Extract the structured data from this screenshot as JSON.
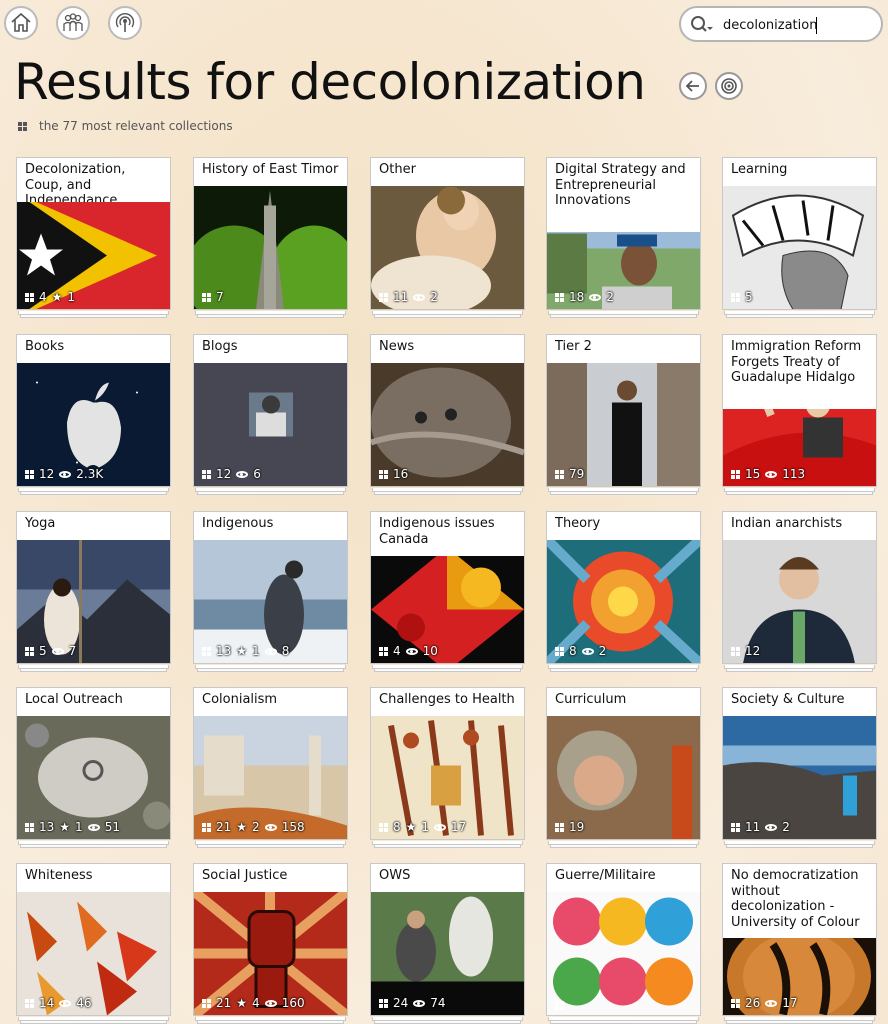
{
  "nav": {
    "home_icon": "home-icon",
    "people_icon": "people-icon",
    "broadcast_icon": "broadcast-icon"
  },
  "search": {
    "value": "decolonization",
    "icon": "search-icon"
  },
  "header": {
    "title": "Results for decolonization",
    "subtitle": "the 77 most relevant collections"
  },
  "collections": [
    {
      "title": "Decolonization, Coup, and Independance",
      "stats": [
        {
          "type": "items",
          "value": "4"
        },
        {
          "type": "stars",
          "value": "1"
        }
      ]
    },
    {
      "title": "History of East Timor",
      "stats": [
        {
          "type": "items",
          "value": "7"
        }
      ]
    },
    {
      "title": "Other",
      "stats": [
        {
          "type": "items",
          "value": "11"
        },
        {
          "type": "views",
          "value": "2"
        }
      ]
    },
    {
      "title": "Digital Strategy and Entrepreneurial Innovations",
      "stats": [
        {
          "type": "items",
          "value": "18"
        },
        {
          "type": "views",
          "value": "2"
        }
      ]
    },
    {
      "title": "Learning",
      "stats": [
        {
          "type": "items",
          "value": "5"
        }
      ]
    },
    {
      "title": "Books",
      "stats": [
        {
          "type": "items",
          "value": "12"
        },
        {
          "type": "views",
          "value": "2.3K"
        }
      ]
    },
    {
      "title": "Blogs",
      "stats": [
        {
          "type": "items",
          "value": "12"
        },
        {
          "type": "views",
          "value": "6"
        }
      ]
    },
    {
      "title": "News",
      "stats": [
        {
          "type": "items",
          "value": "16"
        }
      ]
    },
    {
      "title": "Tier 2",
      "stats": [
        {
          "type": "items",
          "value": "79"
        }
      ]
    },
    {
      "title": "Immigration Reform Forgets Treaty of Guadalupe Hidalgo",
      "stats": [
        {
          "type": "items",
          "value": "15"
        },
        {
          "type": "views",
          "value": "113"
        }
      ]
    },
    {
      "title": "Yoga",
      "stats": [
        {
          "type": "items",
          "value": "5"
        },
        {
          "type": "views",
          "value": "7"
        }
      ]
    },
    {
      "title": "Indigenous",
      "stats": [
        {
          "type": "items",
          "value": "13"
        },
        {
          "type": "stars",
          "value": "1"
        },
        {
          "type": "views",
          "value": "8"
        }
      ]
    },
    {
      "title": "Indigenous issues Canada",
      "stats": [
        {
          "type": "items",
          "value": "4"
        },
        {
          "type": "views",
          "value": "10"
        }
      ]
    },
    {
      "title": "Theory",
      "stats": [
        {
          "type": "items",
          "value": "8"
        },
        {
          "type": "views",
          "value": "2"
        }
      ]
    },
    {
      "title": "Indian anarchists",
      "stats": [
        {
          "type": "items",
          "value": "12"
        }
      ]
    },
    {
      "title": "Local Outreach",
      "stats": [
        {
          "type": "items",
          "value": "13"
        },
        {
          "type": "stars",
          "value": "1"
        },
        {
          "type": "views",
          "value": "51"
        }
      ]
    },
    {
      "title": "Colonialism",
      "stats": [
        {
          "type": "items",
          "value": "21"
        },
        {
          "type": "stars",
          "value": "2"
        },
        {
          "type": "views",
          "value": "158"
        }
      ]
    },
    {
      "title": "Challenges to Health",
      "stats": [
        {
          "type": "items",
          "value": "8"
        },
        {
          "type": "stars",
          "value": "1"
        },
        {
          "type": "views",
          "value": "17"
        }
      ]
    },
    {
      "title": "Curriculum",
      "stats": [
        {
          "type": "items",
          "value": "19"
        }
      ]
    },
    {
      "title": "Society & Culture",
      "stats": [
        {
          "type": "items",
          "value": "11"
        },
        {
          "type": "views",
          "value": "2"
        }
      ]
    },
    {
      "title": "Whiteness",
      "stats": [
        {
          "type": "items",
          "value": "14"
        },
        {
          "type": "views",
          "value": "46"
        }
      ]
    },
    {
      "title": "Social Justice",
      "stats": [
        {
          "type": "items",
          "value": "21"
        },
        {
          "type": "stars",
          "value": "4"
        },
        {
          "type": "views",
          "value": "160"
        }
      ]
    },
    {
      "title": "OWS",
      "stats": [
        {
          "type": "items",
          "value": "24"
        },
        {
          "type": "views",
          "value": "74"
        }
      ]
    },
    {
      "title": "Guerre/Militaire",
      "stats": [
        {
          "type": "items",
          "value": ""
        }
      ]
    },
    {
      "title": "No democratization without decolonization - University of Colour",
      "stats": [
        {
          "type": "items",
          "value": "26"
        },
        {
          "type": "views",
          "value": "17"
        }
      ]
    }
  ]
}
